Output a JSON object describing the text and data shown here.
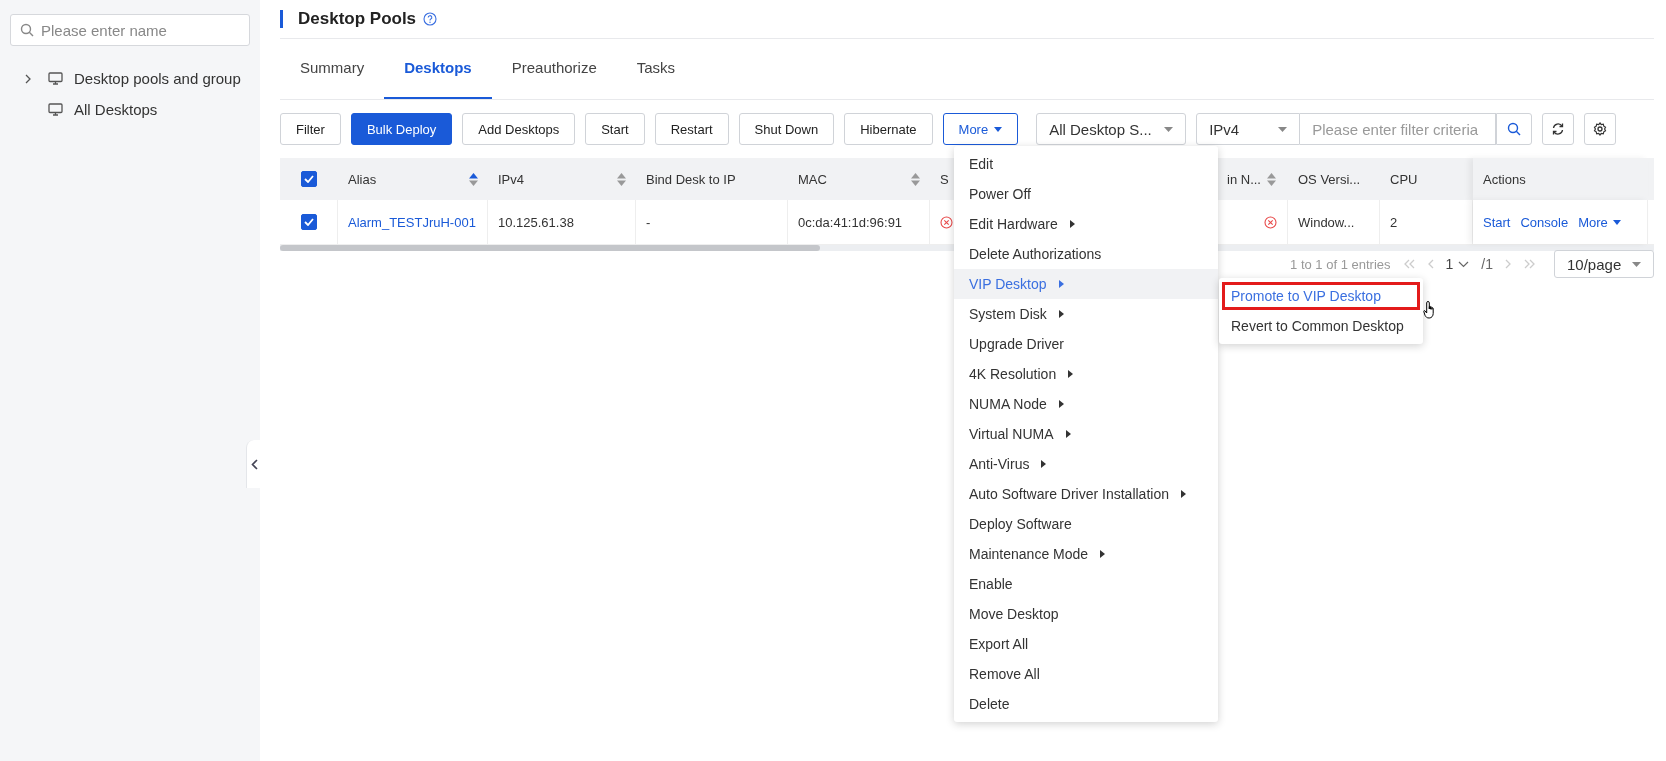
{
  "sidebar": {
    "search": {
      "placeholder": "Please enter name"
    },
    "tree": [
      {
        "label": "Desktop pools and group",
        "kind": "group"
      },
      {
        "label": "All Desktops",
        "kind": "leaf"
      }
    ]
  },
  "page_title": "Desktop Pools",
  "tabs": [
    {
      "label": "Summary",
      "selected": false
    },
    {
      "label": "Desktops",
      "selected": true
    },
    {
      "label": "Preauthorize",
      "selected": false
    },
    {
      "label": "Tasks",
      "selected": false
    }
  ],
  "toolbar": {
    "buttons": [
      {
        "label": "Filter",
        "kind": "default"
      },
      {
        "label": "Bulk Deploy",
        "kind": "primary"
      },
      {
        "label": "Add Desktops",
        "kind": "default"
      },
      {
        "label": "Start",
        "kind": "default"
      },
      {
        "label": "Restart",
        "kind": "default"
      },
      {
        "label": "Shut Down",
        "kind": "default"
      },
      {
        "label": "Hibernate",
        "kind": "default"
      }
    ],
    "more_button": {
      "label": "More",
      "expanded": true
    },
    "status_select": "All Desktop S...",
    "field_select": "IPv4",
    "filter": {
      "placeholder": "Please enter filter criteria"
    }
  },
  "table": {
    "all_checked": true,
    "columns": [
      {
        "label": "Alias",
        "sortable": true,
        "sorted": true
      },
      {
        "label": "IPv4",
        "sortable": true,
        "sorted": false
      },
      {
        "label": "Bind Desk to IP",
        "sortable": false,
        "sorted": false
      },
      {
        "label": "MAC",
        "sortable": true,
        "sorted": false
      },
      {
        "label": "S"
      },
      {
        "label": "in N...",
        "sortable": true,
        "sorted": false
      },
      {
        "label": "OS Versi...",
        "sortable": false,
        "sorted": false
      },
      {
        "label": "CPU",
        "sortable": false,
        "sorted": false
      },
      {
        "label": "Actions",
        "sortable": false,
        "sorted": false
      }
    ],
    "rows": [
      {
        "checked": true,
        "alias": "Alarm_TESTJruH-001",
        "ipv4": "10.125.61.38",
        "bind": "-",
        "mac": "0c:da:41:1d:96:91",
        "os": "Window...",
        "cpu": "2",
        "actions": [
          "Start",
          "Console",
          "More"
        ]
      }
    ]
  },
  "pagination": {
    "summary": "1 to 1 of 1 entries",
    "page": "1",
    "total": "/1",
    "page_size": "10/page"
  },
  "more_menu": [
    {
      "label": "Edit",
      "submenu": false,
      "selected": false
    },
    {
      "label": "Power Off",
      "submenu": false,
      "selected": false
    },
    {
      "label": "Edit Hardware",
      "submenu": true,
      "selected": false
    },
    {
      "label": "Delete Authorizations",
      "submenu": false,
      "selected": false
    },
    {
      "label": "VIP Desktop",
      "submenu": true,
      "selected": true,
      "children": [
        {
          "label": "Promote to VIP Desktop",
          "selected": true
        },
        {
          "label": "Revert to Common Desktop",
          "selected": false
        }
      ]
    },
    {
      "label": "System Disk",
      "submenu": true,
      "selected": false
    },
    {
      "label": "Upgrade Driver",
      "submenu": false,
      "selected": false
    },
    {
      "label": "4K Resolution",
      "submenu": true,
      "selected": false
    },
    {
      "label": "NUMA Node",
      "submenu": true,
      "selected": false
    },
    {
      "label": "Virtual NUMA",
      "submenu": true,
      "selected": false
    },
    {
      "label": "Anti-Virus",
      "submenu": true,
      "selected": false
    },
    {
      "label": "Auto Software Driver Installation",
      "submenu": true,
      "selected": false
    },
    {
      "label": "Deploy Software",
      "submenu": false,
      "selected": false
    },
    {
      "label": "Maintenance Mode",
      "submenu": true,
      "selected": false
    },
    {
      "label": "Enable",
      "submenu": false,
      "selected": false
    },
    {
      "label": "Move Desktop",
      "submenu": false,
      "selected": false
    },
    {
      "label": "Export All",
      "submenu": false,
      "selected": false
    },
    {
      "label": "Remove All",
      "submenu": false,
      "selected": false
    },
    {
      "label": "Delete",
      "submenu": false,
      "selected": false
    }
  ]
}
